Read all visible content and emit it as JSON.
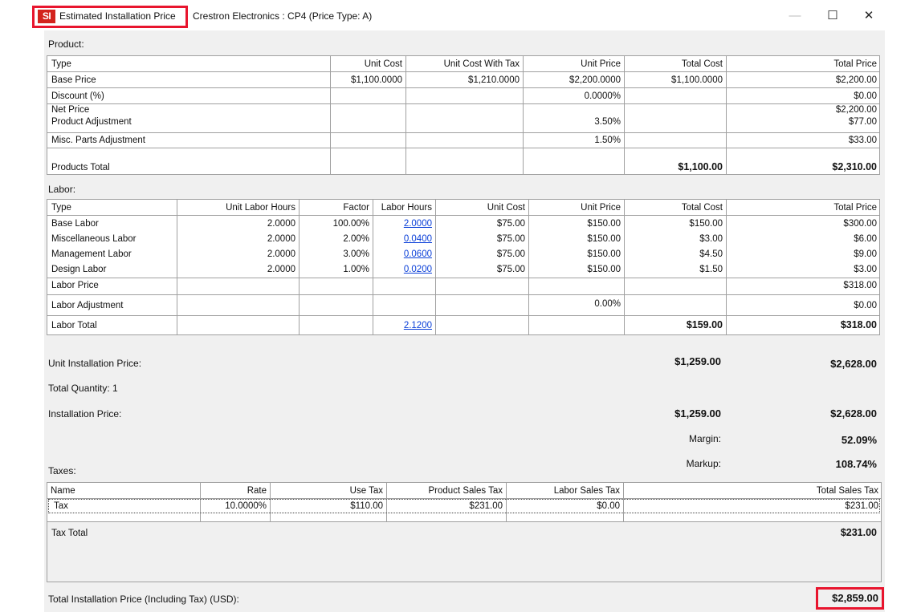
{
  "titlebar": {
    "icon": "SI",
    "title": "Estimated Installation Price",
    "subtitle": "Crestron Electronics : CP4 (Price Type: A)",
    "minimize": "—",
    "maximize": "☐",
    "close": "✕"
  },
  "product": {
    "label": "Product:",
    "headers": [
      "Type",
      "Unit Cost",
      "Unit Cost With Tax",
      "Unit Price",
      "Total Cost",
      "Total Price"
    ],
    "rows": [
      [
        "Base Price",
        "$1,100.0000",
        "$1,210.0000",
        "$2,200.0000",
        "$1,100.0000",
        "$2,200.00"
      ],
      [
        "Discount (%)",
        "",
        "",
        "0.0000%",
        "",
        "$0.00"
      ],
      [
        "Net Price",
        "",
        "",
        "",
        "",
        "$2,200.00"
      ],
      [
        "Product Adjustment",
        "",
        "",
        "3.50%",
        "",
        "$77.00"
      ],
      [
        "Misc. Parts Adjustment",
        "",
        "",
        "1.50%",
        "",
        "$33.00"
      ],
      [
        "Products Total",
        "",
        "",
        "",
        "$1,100.00",
        "$2,310.00"
      ]
    ]
  },
  "labor": {
    "label": "Labor:",
    "headers": [
      "Type",
      "Unit Labor Hours",
      "Factor",
      "Labor Hours",
      "Unit Cost",
      "Unit Price",
      "Total Cost",
      "Total Price"
    ],
    "rows": [
      [
        "Base Labor",
        "2.0000",
        "100.00%",
        "2.0000",
        "$75.00",
        "$150.00",
        "$150.00",
        "$300.00"
      ],
      [
        "Miscellaneous Labor",
        "2.0000",
        "2.00%",
        "0.0400",
        "$75.00",
        "$150.00",
        "$3.00",
        "$6.00"
      ],
      [
        "Management Labor",
        "2.0000",
        "3.00%",
        "0.0600",
        "$75.00",
        "$150.00",
        "$4.50",
        "$9.00"
      ],
      [
        "Design Labor",
        "2.0000",
        "1.00%",
        "0.0200",
        "$75.00",
        "$150.00",
        "$1.50",
        "$3.00"
      ],
      [
        "Labor Price",
        "",
        "",
        "",
        "",
        "",
        "",
        "$318.00"
      ],
      [
        "Labor Adjustment",
        "",
        "",
        "",
        "",
        "0.00%",
        "",
        "$0.00"
      ],
      [
        "Labor Total",
        "",
        "",
        "2.1200",
        "",
        "",
        "$159.00",
        "$318.00"
      ]
    ]
  },
  "summary": {
    "unit_installation_label": "Unit Installation Price:",
    "unit_installation_cost": "$1,259.00",
    "unit_installation_price": "$2,628.00",
    "total_quantity": "Total Quantity: 1",
    "installation_label": "Installation Price:",
    "installation_cost": "$1,259.00",
    "installation_price": "$2,628.00",
    "margin_label": "Margin:",
    "margin_value": "52.09%",
    "markup_label": "Markup:",
    "markup_value": "108.74%"
  },
  "taxes": {
    "label": "Taxes:",
    "headers": [
      "Name",
      "Rate",
      "Use Tax",
      "Product Sales Tax",
      "Labor Sales Tax",
      "Total Sales Tax"
    ],
    "rows": [
      [
        "Tax",
        "10.0000%",
        "$110.00",
        "$231.00",
        "$0.00",
        "$231.00"
      ]
    ],
    "total_label": "Tax Total",
    "total_value": "$231.00"
  },
  "grand_total": {
    "label": "Total Installation Price (Including Tax) (USD):",
    "value": "$2,859.00"
  },
  "colors": {
    "highlight": "#e8152e",
    "link": "#0a3fd8",
    "dialog_bg": "#f0f0f0"
  }
}
